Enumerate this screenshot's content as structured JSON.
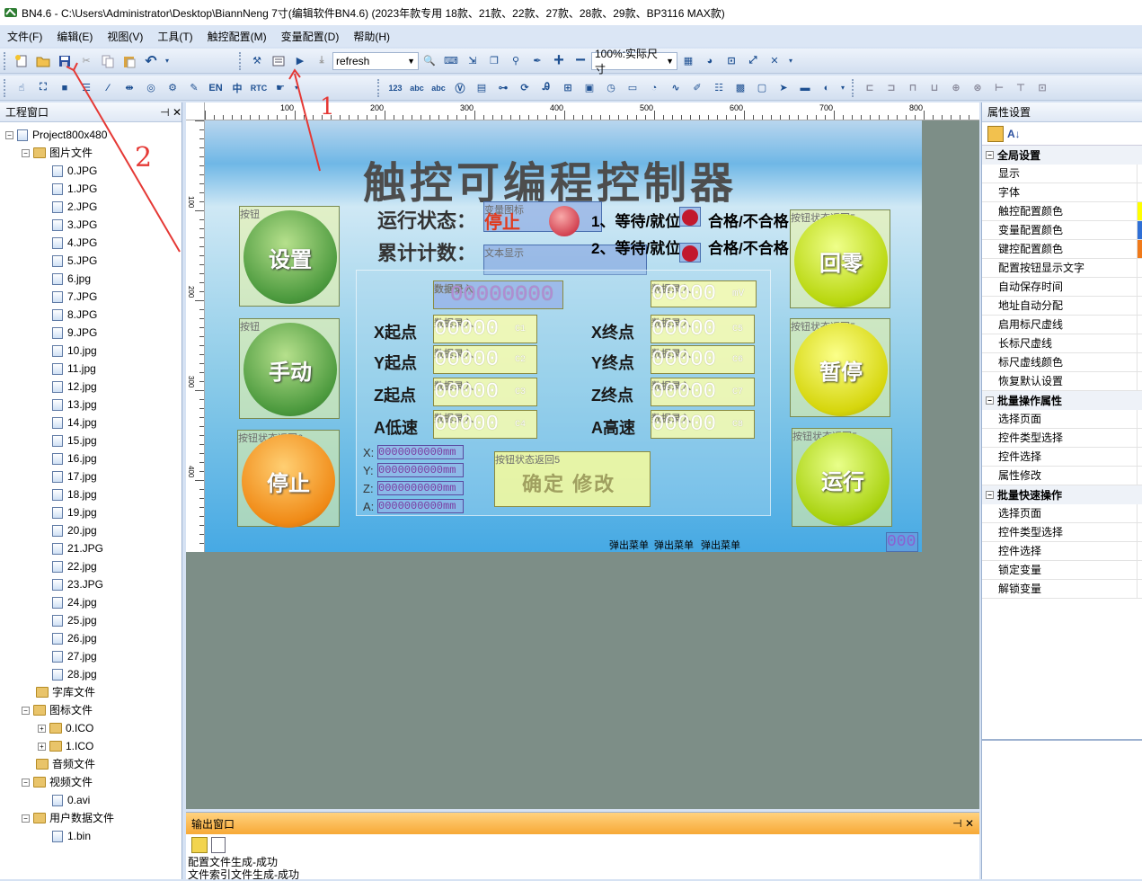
{
  "window": {
    "title": "BN4.6 - C:\\Users\\Administrator\\Desktop\\BiannNeng 7寸(编辑软件BN4.6) (2023年款专用 18款、21款、22款、27款、28款、29款、BP3116 MAX款)"
  },
  "menu": [
    "文件(F)",
    "编辑(E)",
    "视图(V)",
    "工具(T)",
    "触控配置(M)",
    "变量配置(D)",
    "帮助(H)"
  ],
  "toolbar": {
    "refresh_value": "refresh",
    "zoom_value": "100%:实际尺寸",
    "en_label": "EN",
    "zh_label": "中",
    "rtc_label": "RTC",
    "num_label": "123",
    "abc_label": "abc"
  },
  "left_panel": {
    "title": "工程窗口",
    "project": "Project800x480",
    "image_folder": "图片文件",
    "images": [
      "0.JPG",
      "1.JPG",
      "2.JPG",
      "3.JPG",
      "4.JPG",
      "5.JPG",
      "6.jpg",
      "7.JPG",
      "8.JPG",
      "9.JPG",
      "10.jpg",
      "11.jpg",
      "12.jpg",
      "13.jpg",
      "14.jpg",
      "15.jpg",
      "16.jpg",
      "17.jpg",
      "18.jpg",
      "19.jpg",
      "20.jpg",
      "21.JPG",
      "22.jpg",
      "23.JPG",
      "24.jpg",
      "25.jpg",
      "26.jpg",
      "27.jpg",
      "28.jpg"
    ],
    "font_folder": "字库文件",
    "icon_folder": "图标文件",
    "icons": [
      "0.ICO",
      "1.ICO"
    ],
    "audio_folder": "音频文件",
    "video_folder": "视频文件",
    "videos": [
      "0.avi"
    ],
    "user_folder": "用户数据文件",
    "user_files": [
      "1.bin"
    ]
  },
  "ruler": {
    "top": [
      "100",
      "200",
      "300",
      "400",
      "500",
      "600",
      "700",
      "800"
    ],
    "left": [
      "100",
      "200",
      "300",
      "400"
    ]
  },
  "design": {
    "title": "触控可编程控制器",
    "status_label": "运行状态：",
    "status_value": "停止",
    "count_label": "累计计数：",
    "var_icon_label": "变量图标",
    "text_display_label": "文本显示",
    "state1": "1、等待/就位",
    "state2": "2、等待/就位",
    "pass_fail": "合格/不合格",
    "icon_tag": "变图标",
    "button_tag": "按钮",
    "button_state_tag": "按钮状态返回5",
    "button_state_tag6": "按钮状态返回6",
    "data_entry_tag": "数据录入",
    "btn_setup": "设置",
    "btn_manual": "手动",
    "btn_stop": "停止",
    "btn_home": "回零",
    "btn_pause": "暂停",
    "btn_run": "运行",
    "btn_confirm": "确定 修改",
    "rows_left": [
      "X起点",
      "Y起点",
      "Z起点",
      "A低速"
    ],
    "rows_right": [
      "X终点",
      "Y终点",
      "Z终点",
      "A高速"
    ],
    "units_left": [
      "c1",
      "c2",
      "c3",
      "c4"
    ],
    "units_right": [
      "c5",
      "c6",
      "c7",
      "c8"
    ],
    "top_field": "00000000",
    "top_right_field": "00000",
    "mv_unit": "mV",
    "field_value": "00000",
    "coords": [
      {
        "axis": "X:",
        "value": "0000000000mm"
      },
      {
        "axis": "Y:",
        "value": "0000000000mm"
      },
      {
        "axis": "Z:",
        "value": "0000000000mm"
      },
      {
        "axis": "A:",
        "value": "0000000000mm"
      }
    ],
    "menu_tags": [
      "弹出菜单",
      "弹出菜单",
      "弹出菜单"
    ],
    "corner_value": "000"
  },
  "right_panel": {
    "title": "属性设置",
    "sections": [
      {
        "name": "全局设置",
        "items": [
          "显示",
          "字体",
          "触控配置颜色",
          "变量配置颜色",
          "键控配置颜色",
          "配置按钮显示文字",
          "自动保存时间",
          "地址自动分配",
          "启用标尺虚线",
          "长标尺虚线",
          "标尺虚线颜色",
          "恢复默认设置"
        ]
      },
      {
        "name": "批量操作属性",
        "items": [
          "选择页面",
          "控件类型选择",
          "控件选择",
          "属性修改"
        ]
      },
      {
        "name": "批量快速操作",
        "items": [
          "选择页面",
          "控件类型选择",
          "控件选择",
          "锁定变量",
          "解锁变量"
        ]
      }
    ]
  },
  "output": {
    "title": "输出窗口",
    "lines": [
      "配置文件生成-成功",
      "文件索引文件生成-成功"
    ]
  },
  "annotations": {
    "mark1": "1",
    "mark2": "2"
  },
  "colors": {
    "touch": "#ffff00",
    "variable": "#2f6fd6",
    "keyctl": "#f07a1a"
  }
}
